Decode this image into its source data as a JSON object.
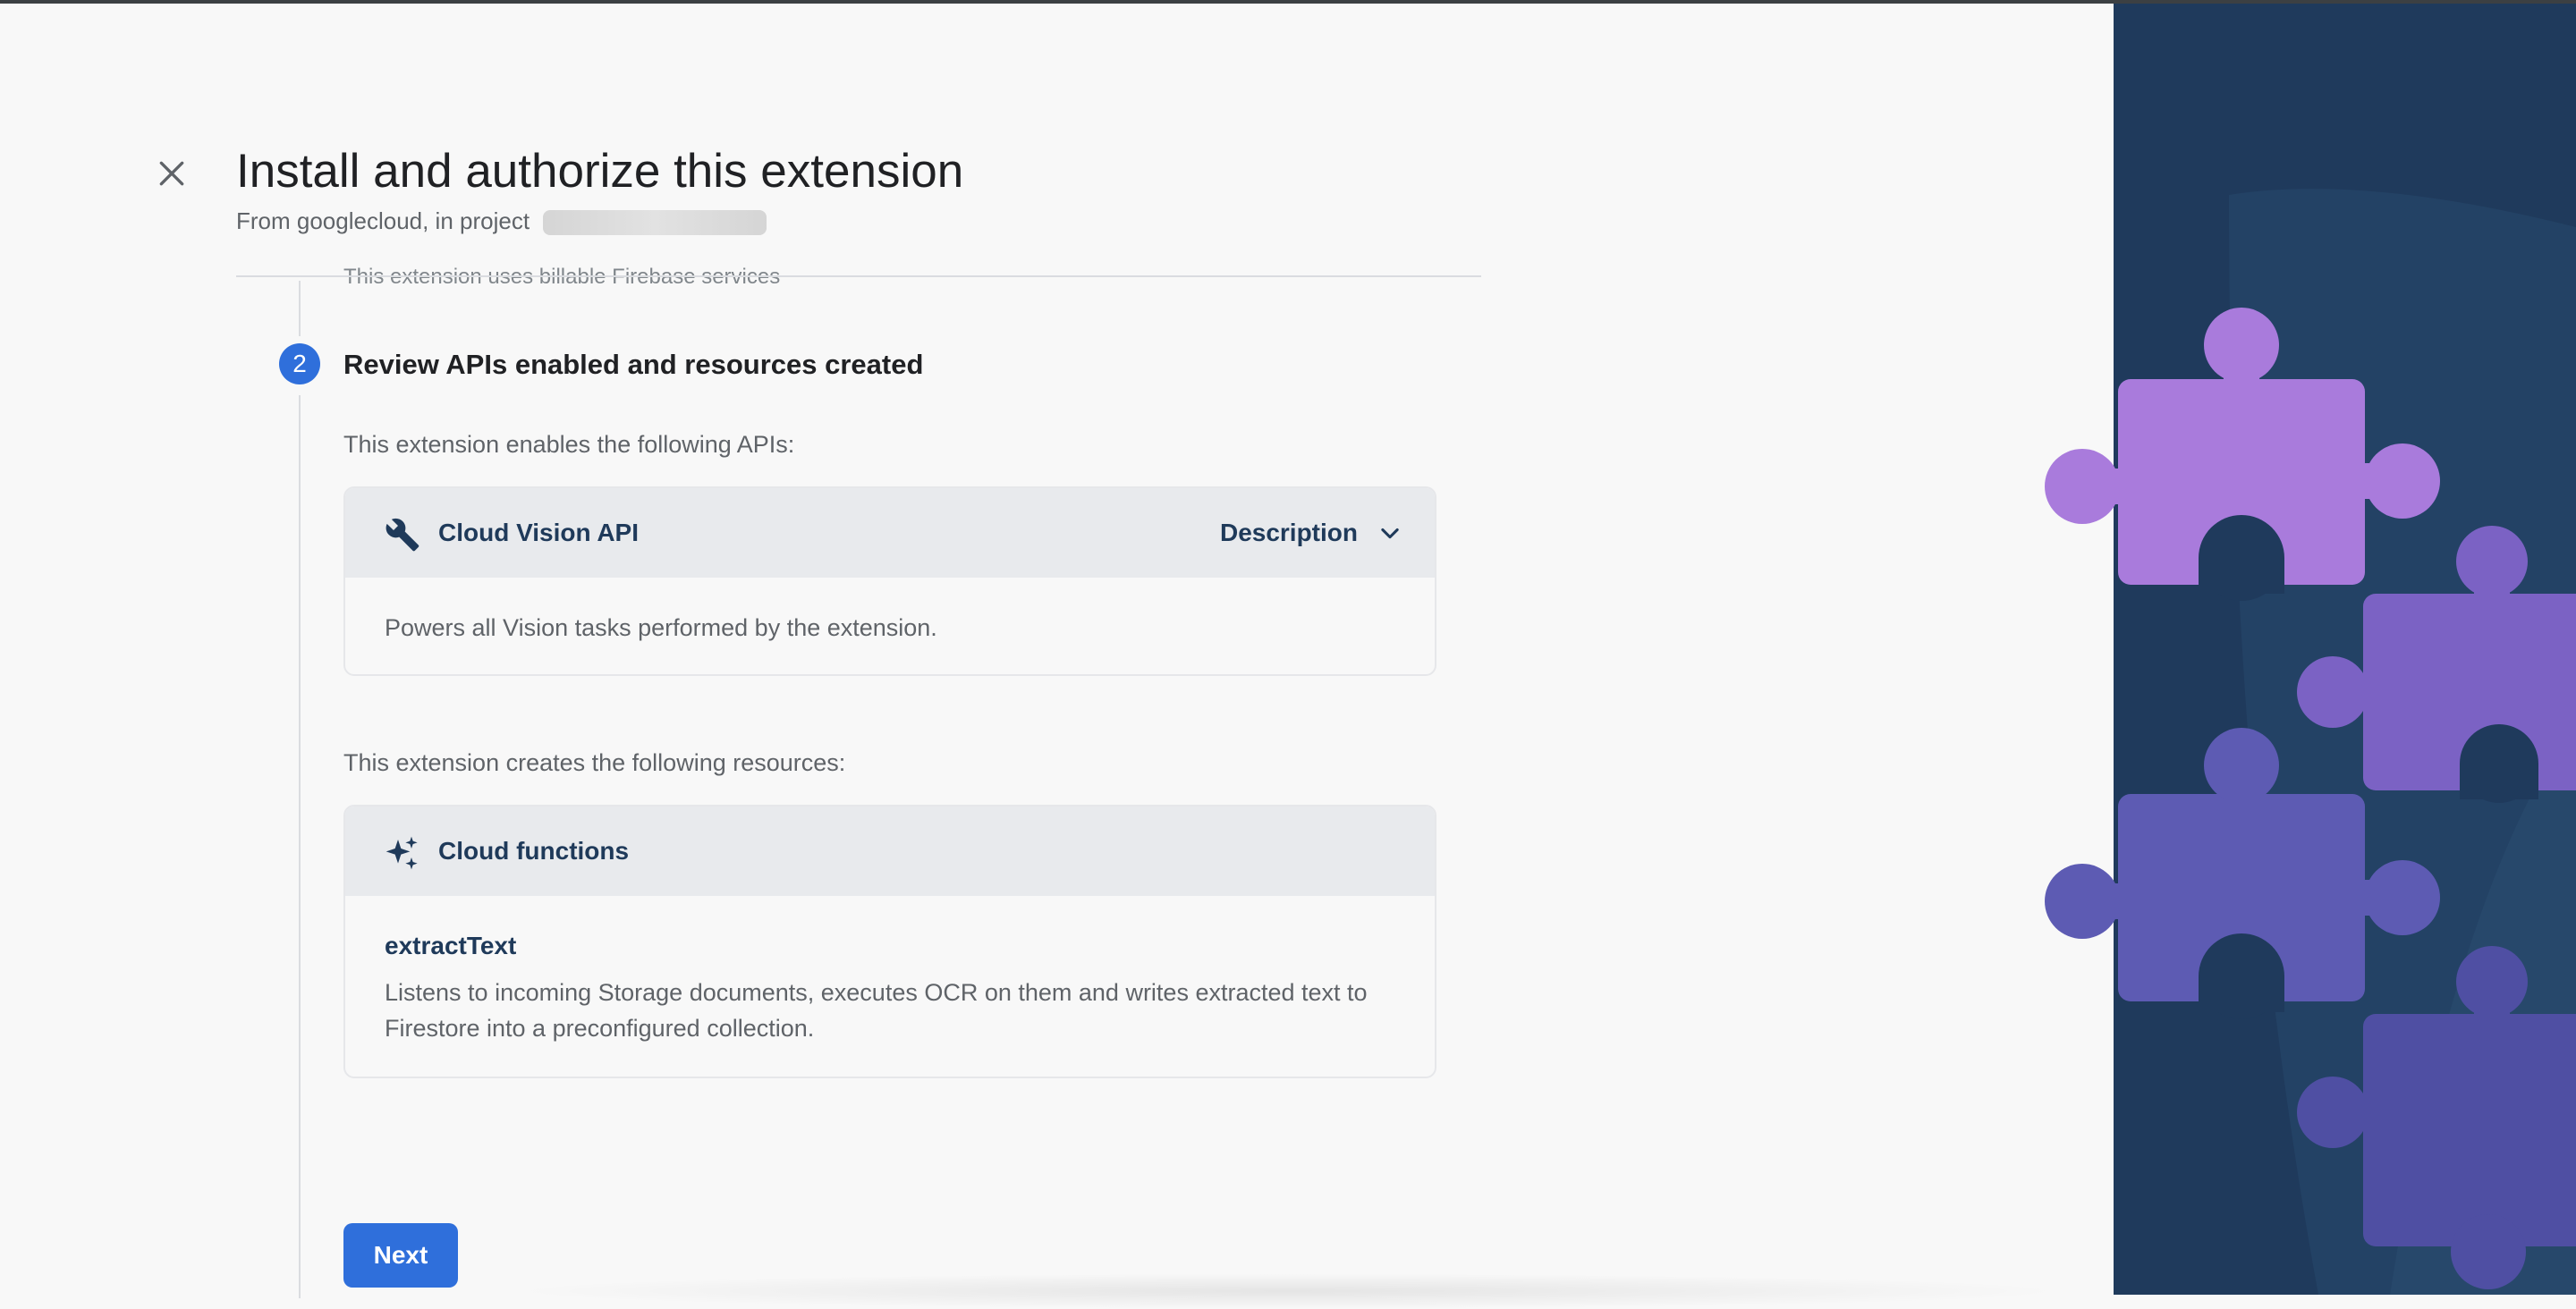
{
  "dialog": {
    "title": "Install and authorize this extension",
    "subtitle_prefix": "From googlecloud, in project",
    "cut_text": "This extension uses billable Firebase services"
  },
  "step": {
    "number": "2",
    "title": "Review APIs enabled and resources created"
  },
  "apis": {
    "lead": "This extension enables the following APIs:",
    "items": [
      {
        "icon": "wrench-icon",
        "name": "Cloud Vision API",
        "toggle_label": "Description",
        "description": "Powers all Vision tasks performed by the extension."
      }
    ]
  },
  "resources": {
    "lead": "This extension creates the following resources:",
    "card_title": "Cloud functions",
    "card_icon": "sparkle-icon",
    "items": [
      {
        "name": "extractText",
        "description": "Listens to incoming Storage documents, executes OCR on them and writes extracted text to Firestore into a preconfigured collection."
      }
    ]
  },
  "actions": {
    "next_label": "Next"
  },
  "colors": {
    "accent": "#2f6fdb",
    "sidebar_bg": "#1f3a5c",
    "puzzle_purple": "#a97bdc",
    "puzzle_violet": "#7b62c4",
    "puzzle_indigo": "#5d5bb3"
  }
}
